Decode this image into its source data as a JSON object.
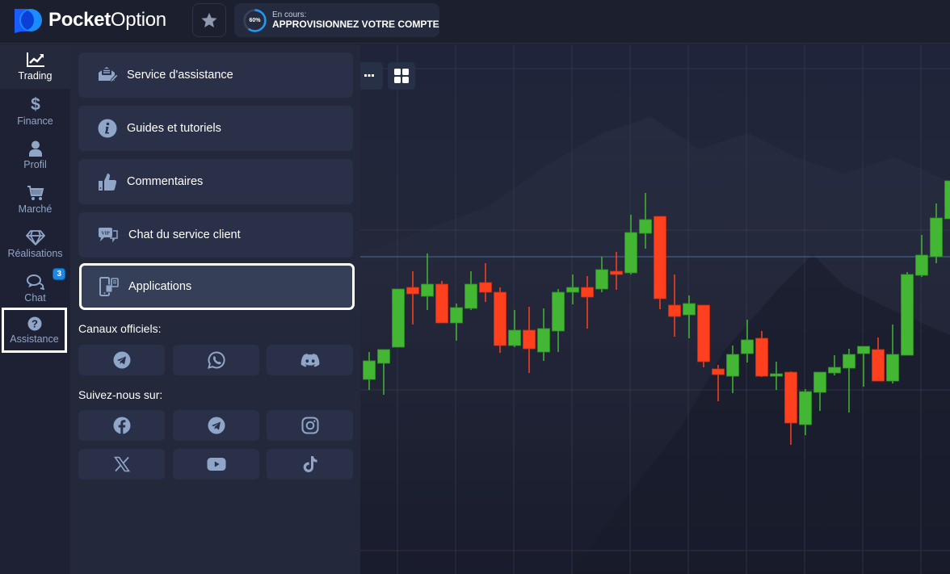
{
  "app": {
    "logo_bold": "Pocket",
    "logo_light": "Option",
    "brand_color": "#1a5cff"
  },
  "topbar": {
    "favorites_icon": "star-icon",
    "progress": {
      "label": "En cours:",
      "title": "APPROVISIONNEZ VOTRE COMPTE",
      "percent_text": "60%",
      "percent": 60,
      "ring_color": "#1e9bf0"
    }
  },
  "sidebar": {
    "items": [
      {
        "label": "Trading",
        "icon": "chart-line-icon",
        "active": true
      },
      {
        "label": "Finance",
        "icon": "dollar-icon"
      },
      {
        "label": "Profil",
        "icon": "user-icon"
      },
      {
        "label": "Marché",
        "icon": "cart-icon"
      },
      {
        "label": "Réalisations",
        "icon": "diamond-icon"
      },
      {
        "label": "Chat",
        "icon": "chat-icon",
        "badge": "3"
      },
      {
        "label": "Assistance",
        "icon": "question-icon",
        "selected": true
      }
    ]
  },
  "panel": {
    "menu": [
      {
        "label": "Service d'assistance",
        "icon": "support-ticket-icon"
      },
      {
        "label": "Guides et tutoriels",
        "icon": "info-icon"
      },
      {
        "label": "Commentaires",
        "icon": "thumbs-up-icon"
      },
      {
        "label": "Chat du service client",
        "icon": "vip-chat-icon"
      },
      {
        "label": "Applications",
        "icon": "apps-devices-icon",
        "highlighted": true
      }
    ],
    "official_channels_label": "Canaux officiels:",
    "official_channels": [
      {
        "name": "telegram",
        "icon": "telegram-icon"
      },
      {
        "name": "whatsapp",
        "icon": "whatsapp-icon"
      },
      {
        "name": "discord",
        "icon": "discord-icon"
      }
    ],
    "follow_label": "Suivez-nous sur:",
    "follow": [
      {
        "name": "facebook",
        "icon": "facebook-icon"
      },
      {
        "name": "telegram",
        "icon": "telegram-icon"
      },
      {
        "name": "instagram",
        "icon": "instagram-icon"
      },
      {
        "name": "x",
        "icon": "x-icon"
      },
      {
        "name": "youtube",
        "icon": "youtube-icon"
      },
      {
        "name": "tiktok",
        "icon": "tiktok-icon"
      }
    ]
  },
  "chart": {
    "tools": [
      {
        "name": "more",
        "icon": "ellipsis-icon"
      },
      {
        "name": "layout",
        "icon": "grid-icon"
      }
    ],
    "colors": {
      "up": "#43b734",
      "down": "#ff401f",
      "current_line": "#4a6a9a"
    },
    "current_price": 98.25
  },
  "chart_data": {
    "type": "candlestick",
    "note": "Price units are relative (no axis labels visible)",
    "price_range": [
      40,
      125
    ],
    "candles": [
      {
        "o": 60.25,
        "c": 66.0,
        "h": 68.75,
        "l": 57.0
      },
      {
        "o": 65.25,
        "c": 69.5,
        "h": 69.5,
        "l": 55.5
      },
      {
        "o": 70.25,
        "c": 88.25,
        "h": 88.25,
        "l": 70.25
      },
      {
        "o": 88.75,
        "c": 86.75,
        "h": 93.75,
        "l": 77.25
      },
      {
        "o": 86.0,
        "c": 89.75,
        "h": 99.25,
        "l": 81.75
      },
      {
        "o": 89.75,
        "c": 77.75,
        "h": 90.75,
        "l": 77.75
      },
      {
        "o": 77.75,
        "c": 82.5,
        "h": 83.75,
        "l": 72.25
      },
      {
        "o": 82.25,
        "c": 89.75,
        "h": 93.75,
        "l": 81.75
      },
      {
        "o": 90.25,
        "c": 87.25,
        "h": 96.25,
        "l": 84.25
      },
      {
        "o": 87.25,
        "c": 70.75,
        "h": 88.75,
        "l": 68.5
      },
      {
        "o": 70.75,
        "c": 75.5,
        "h": 81.75,
        "l": 70.25
      },
      {
        "o": 75.5,
        "c": 69.75,
        "h": 82.75,
        "l": 62.25
      },
      {
        "o": 68.75,
        "c": 76.0,
        "h": 82.25,
        "l": 66.0
      },
      {
        "o": 75.25,
        "c": 87.25,
        "h": 88.25,
        "l": 68.75
      },
      {
        "o": 87.25,
        "c": 88.75,
        "h": 92.75,
        "l": 83.5
      },
      {
        "o": 88.75,
        "c": 85.75,
        "h": 92.25,
        "l": 76.0
      },
      {
        "o": 88.25,
        "c": 94.25,
        "h": 98.25,
        "l": 87.25
      },
      {
        "o": 93.75,
        "c": 92.75,
        "h": 99.75,
        "l": 88.0
      },
      {
        "o": 93.25,
        "c": 105.75,
        "h": 111.25,
        "l": 92.75
      },
      {
        "o": 105.5,
        "c": 109.75,
        "h": 118.0,
        "l": 100.75
      },
      {
        "o": 110.75,
        "c": 85.25,
        "h": 110.75,
        "l": 82.0
      },
      {
        "o": 83.25,
        "c": 79.75,
        "h": 92.75,
        "l": 73.5
      },
      {
        "o": 80.25,
        "c": 83.75,
        "h": 86.25,
        "l": 73.0
      },
      {
        "o": 83.25,
        "c": 65.75,
        "h": 83.25,
        "l": 64.0
      },
      {
        "o": 63.5,
        "c": 61.75,
        "h": 64.75,
        "l": 53.5
      },
      {
        "o": 61.25,
        "c": 68.0,
        "h": 70.75,
        "l": 56.0
      },
      {
        "o": 68.25,
        "c": 72.5,
        "h": 78.75,
        "l": 65.5
      },
      {
        "o": 73.0,
        "c": 61.25,
        "h": 75.25,
        "l": 61.0
      },
      {
        "o": 61.25,
        "c": 62.0,
        "h": 65.75,
        "l": 57.0
      },
      {
        "o": 62.5,
        "c": 46.75,
        "h": 62.75,
        "l": 40.0
      },
      {
        "o": 46.25,
        "c": 56.5,
        "h": 57.25,
        "l": 43.0
      },
      {
        "o": 56.25,
        "c": 62.5,
        "h": 62.5,
        "l": 50.5
      },
      {
        "o": 62.25,
        "c": 64.0,
        "h": 67.75,
        "l": 61.5
      },
      {
        "o": 63.75,
        "c": 68.0,
        "h": 69.75,
        "l": 50.0
      },
      {
        "o": 68.25,
        "c": 70.5,
        "h": 70.5,
        "l": 58.0
      },
      {
        "o": 69.5,
        "c": 59.75,
        "h": 73.25,
        "l": 59.75
      },
      {
        "o": 59.75,
        "c": 68.0,
        "h": 77.25,
        "l": 59.0
      },
      {
        "o": 67.75,
        "c": 92.75,
        "h": 93.5,
        "l": 67.75
      },
      {
        "o": 92.5,
        "c": 98.75,
        "h": 105.0,
        "l": 92.0
      },
      {
        "o": 98.25,
        "c": 110.25,
        "h": 114.75,
        "l": 96.25
      },
      {
        "o": 110.0,
        "c": 121.75,
        "h": 121.75,
        "l": 110.0
      }
    ]
  }
}
